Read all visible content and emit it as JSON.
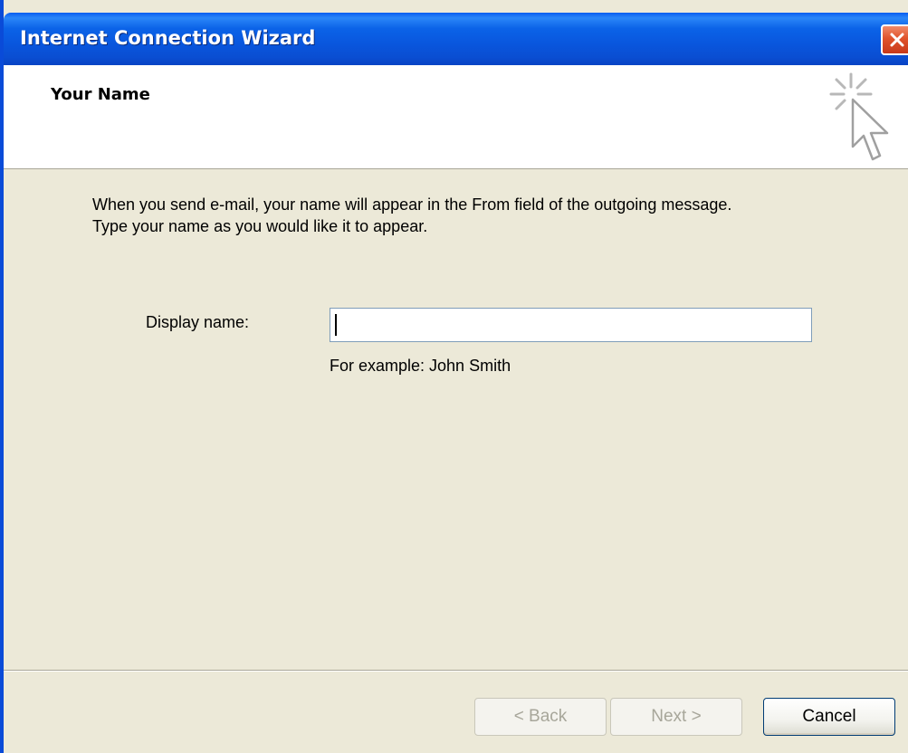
{
  "window": {
    "title": "Internet Connection Wizard",
    "accent_color": "#0a5ef0",
    "close_color": "#e0532b"
  },
  "header": {
    "title": "Your Name",
    "icon": "wizard-cursor-icon"
  },
  "body": {
    "line1": "When you send e-mail, your name will appear in the From field of the outgoing message.",
    "line2": "Type your name as you would like it to appear."
  },
  "form": {
    "display_name_label": "Display name:",
    "display_name_value": "",
    "example": "For example: John Smith"
  },
  "buttons": {
    "back": "< Back",
    "next": "Next >",
    "cancel": "Cancel"
  }
}
